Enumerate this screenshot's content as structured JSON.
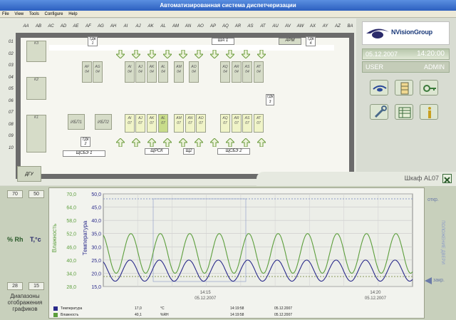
{
  "window": {
    "title": "Автоматизированная система диспетчеризации"
  },
  "menu": [
    "File",
    "View",
    "Tools",
    "Configure",
    "Help"
  ],
  "floor": {
    "columns": [
      "AA",
      "AB",
      "AC",
      "AD",
      "AE",
      "AF",
      "AG",
      "AH",
      "AI",
      "AJ",
      "AK",
      "AL",
      "AM",
      "AN",
      "AO",
      "AP",
      "AQ",
      "AR",
      "AS",
      "AT",
      "AU",
      "AV",
      "AW",
      "AX",
      "AY",
      "AZ",
      "BA"
    ],
    "rows": [
      "01",
      "02",
      "03",
      "04",
      "05",
      "06",
      "07",
      "08",
      "09",
      "10"
    ],
    "left_cabinets": [
      "K3",
      "K2",
      "K1"
    ],
    "top_cabinets": [
      {
        "a": "AF",
        "b": "04"
      },
      {
        "a": "AG",
        "b": "04"
      },
      {
        "a": "AI",
        "b": "04"
      },
      {
        "a": "AJ",
        "b": "04"
      },
      {
        "a": "AK",
        "b": "04"
      },
      {
        "a": "AL",
        "b": "04"
      },
      {
        "a": "AM",
        "b": "04"
      },
      {
        "a": "AO",
        "b": "04"
      },
      {
        "a": "AQ",
        "b": "04"
      },
      {
        "a": "AR",
        "b": "04"
      },
      {
        "a": "AS",
        "b": "04"
      },
      {
        "a": "AT",
        "b": "04"
      }
    ],
    "bottom_cabinets": [
      {
        "a": "AI",
        "b": "07"
      },
      {
        "a": "AJ",
        "b": "07"
      },
      {
        "a": "AK",
        "b": "07"
      },
      {
        "a": "AL",
        "b": "07"
      },
      {
        "a": "AM",
        "b": "07"
      },
      {
        "a": "AN",
        "b": "07"
      },
      {
        "a": "AO",
        "b": "07"
      },
      {
        "a": "AQ",
        "b": "07"
      },
      {
        "a": "AR",
        "b": "07"
      },
      {
        "a": "AS",
        "b": "07"
      },
      {
        "a": "AT",
        "b": "07"
      }
    ],
    "ups": [
      "ИБП1",
      "ИБП2"
    ],
    "labels": {
      "tdk1": "ТДК 1",
      "tdk2": "ТДК 2",
      "tdk3": "ТДК 3",
      "tdk4": "ТДК 4",
      "sh1": "ША 1",
      "arm": "АРМ",
      "shsge1": "ЩСБЭ 1",
      "shrsk": "ЩРСК",
      "shch": "Щ2",
      "shsge2": "ЩСБЭ 2",
      "dgu": "ДГУ"
    }
  },
  "status": {
    "date": "05.12.2007",
    "time": "14:20:00",
    "user_label": "USER",
    "user_name": "ADMIN",
    "logo": "NVisionGroup"
  },
  "detail": {
    "title": "Шкаф AL07",
    "close_icon": "close-icon",
    "y_ranges": {
      "rh_max": "70",
      "t_max": "50",
      "rh_min": "28",
      "t_min": "15"
    },
    "unit_rh": "% Rh",
    "unit_t": "T,°c",
    "range_caption": "Диапазоны отображения графиков",
    "door_label": "ПОЛОЖЕНИЕ ДВЕРИ",
    "door_open": "откр.",
    "door_closed": "закр."
  },
  "chart_data": {
    "type": "line",
    "ylabel_left": "Влажность",
    "ylabel_right": "Температура",
    "humidity_ticks": [
      "70,0",
      "64,0",
      "58,0",
      "52,0",
      "46,0",
      "40,0",
      "34,0",
      "28,0"
    ],
    "temperature_ticks": [
      "50,0",
      "45,0",
      "40,0",
      "35,0",
      "30,0",
      "25,0",
      "20,0",
      "15,0"
    ],
    "x_ticks": [
      {
        "time": "14:15",
        "date": "05.12.2007"
      },
      {
        "time": "14:20",
        "date": "05.12.2007"
      }
    ],
    "series": [
      {
        "name": "Влажность",
        "color": "#5c9e3c",
        "axis": "humidity",
        "min": 34,
        "max": 52,
        "periods": 10.5
      },
      {
        "name": "Температура",
        "color": "#2a2a8a",
        "axis": "temperature",
        "min": 17,
        "max": 25,
        "periods": 10.5
      }
    ],
    "legend": [
      {
        "name": "Температура",
        "value": "17,0",
        "unit": "°C",
        "time": "14:19:58",
        "date": "05.12.2007",
        "color": "#2a2a8a"
      },
      {
        "name": "Влажность",
        "value": "40,1",
        "unit": "%RH",
        "time": "14:19:58",
        "date": "05.12.2007",
        "color": "#5c9e3c"
      }
    ]
  }
}
